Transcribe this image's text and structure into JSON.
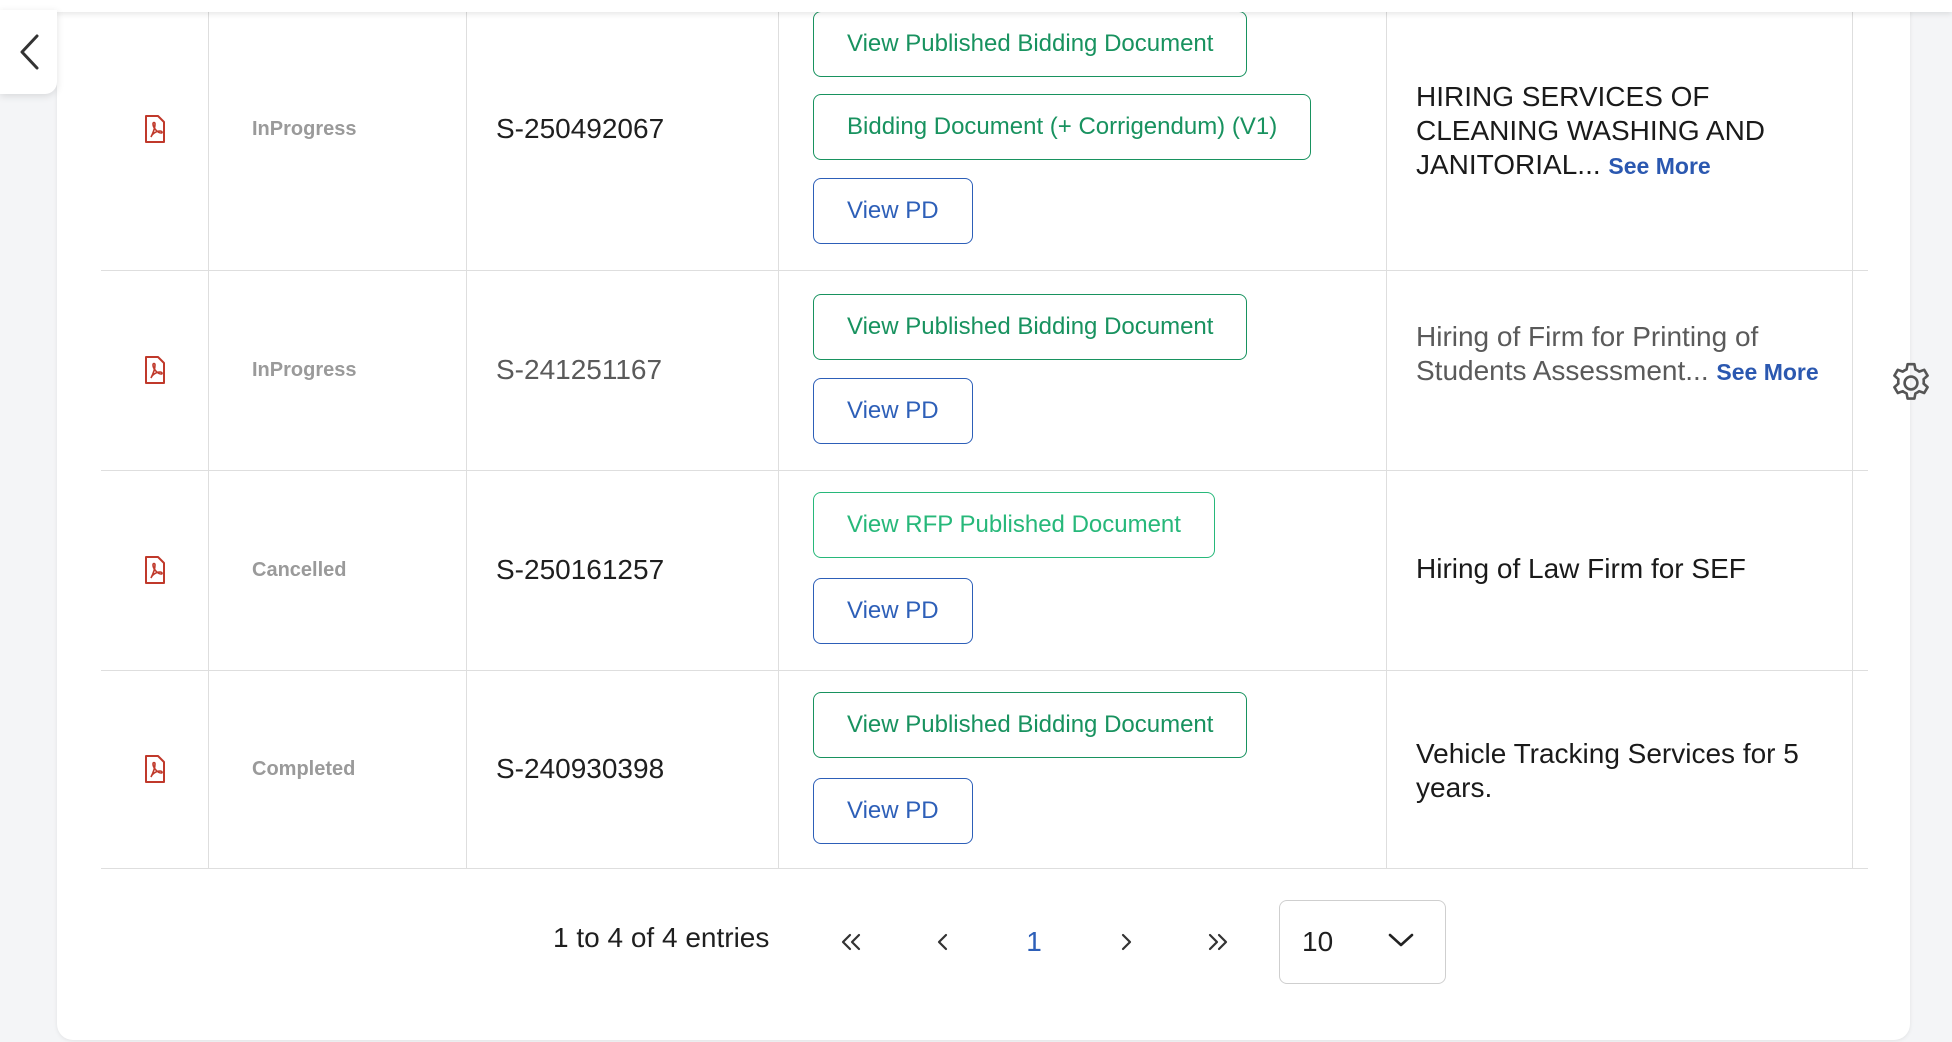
{
  "colors": {
    "status_text": "#9a9a9a",
    "green_button": "#18925f",
    "green_button_light": "#27b87a",
    "blue_button": "#2d5fb8",
    "see_more": "#2b58b0",
    "pdf_icon": "#c0392b"
  },
  "nav": {
    "back_icon": "chevron-left-icon"
  },
  "settings": {
    "icon": "gear-icon"
  },
  "rows": [
    {
      "status": "InProgress",
      "reference": "S-250492067",
      "buttons": [
        {
          "label": "View Published Bidding Document",
          "style": "green"
        },
        {
          "label": "Bidding Document (+ Corrigendum) (V1)",
          "style": "green"
        },
        {
          "label": "View PD",
          "style": "blue"
        }
      ],
      "description": "HIRING SERVICES OF CLEANING WASHING AND JANITORIAL...",
      "see_more": "See More"
    },
    {
      "status": "InProgress",
      "reference": "S-241251167",
      "buttons": [
        {
          "label": "View Published Bidding Document",
          "style": "green"
        },
        {
          "label": "View PD",
          "style": "blue"
        }
      ],
      "description": "Hiring of Firm for Printing of Students Assessment...",
      "see_more": "See More"
    },
    {
      "status": "Cancelled",
      "reference": "S-250161257",
      "buttons": [
        {
          "label": "View RFP Published Document",
          "style": "green2"
        },
        {
          "label": "View PD",
          "style": "blue"
        }
      ],
      "description": "Hiring of Law Firm for SEF",
      "see_more": ""
    },
    {
      "status": "Completed",
      "reference": "S-240930398",
      "buttons": [
        {
          "label": "View Published Bidding Document",
          "style": "green"
        },
        {
          "label": "View PD",
          "style": "blue"
        }
      ],
      "description": "Vehicle Tracking Services for 5 years.",
      "see_more": ""
    }
  ],
  "pagination": {
    "info": "1 to 4 of 4 entries",
    "first_icon": "chevrons-left-icon",
    "prev_icon": "chevron-left-icon",
    "current_page": "1",
    "next_icon": "chevron-right-icon",
    "last_icon": "chevrons-right-icon",
    "page_size": "10"
  }
}
